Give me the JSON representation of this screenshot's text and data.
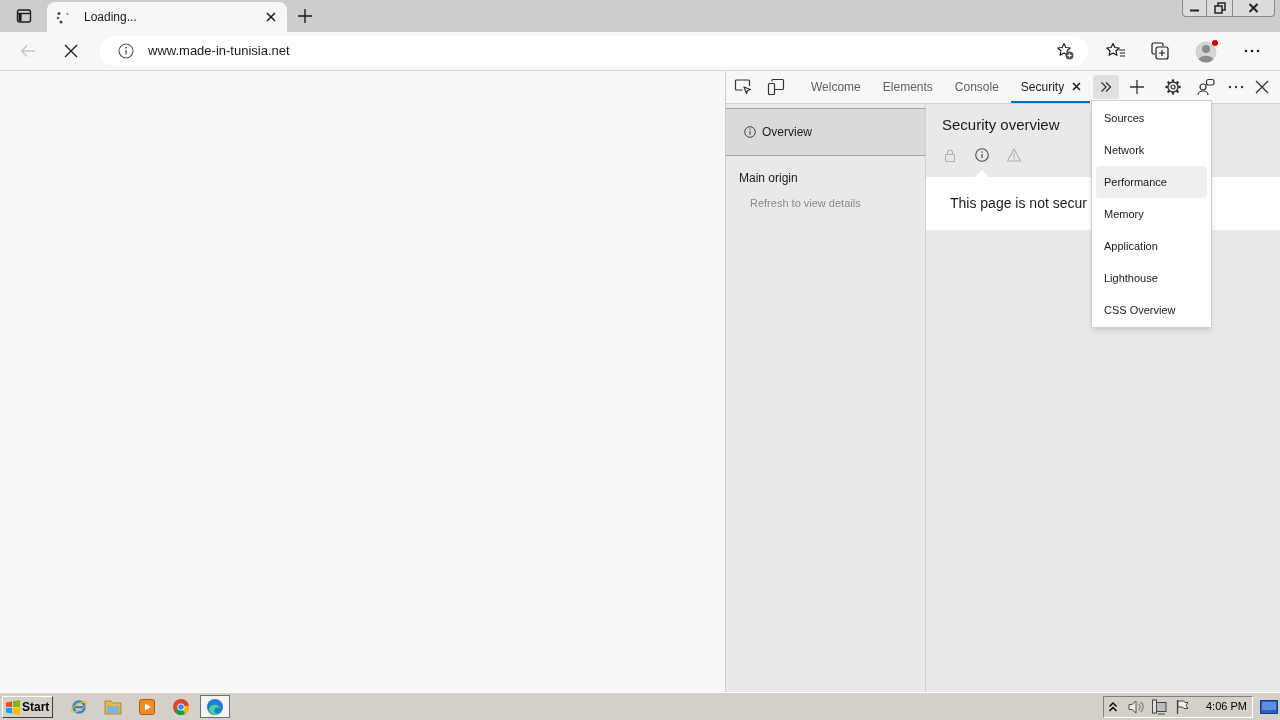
{
  "browser": {
    "tabs": [
      {
        "title": "Loading...",
        "loading": true,
        "selected": true
      }
    ],
    "navigation": {
      "back": {
        "disabled": true
      }
    },
    "address_bar": {
      "url": "www.made-in-tunisia.net"
    }
  },
  "devtools": {
    "tabs": [
      {
        "label": "Welcome",
        "selected": false
      },
      {
        "label": "Elements",
        "selected": false
      },
      {
        "label": "Console",
        "selected": false
      },
      {
        "label": "Security",
        "selected": true
      }
    ],
    "more_tabs_menu": {
      "open": true,
      "items": [
        {
          "label": "Sources",
          "highlighted": false
        },
        {
          "label": "Network",
          "highlighted": false
        },
        {
          "label": "Performance",
          "highlighted": true
        },
        {
          "label": "Memory",
          "highlighted": false
        },
        {
          "label": "Application",
          "highlighted": false
        },
        {
          "label": "Lighthouse",
          "highlighted": false
        },
        {
          "label": "CSS Overview",
          "highlighted": false
        }
      ]
    },
    "sidebar": {
      "items": [
        {
          "label": "Overview",
          "selected": true
        }
      ],
      "sections": [
        {
          "title": "Main origin",
          "hint": "Refresh to view details"
        }
      ]
    },
    "panel": {
      "title": "Security overview",
      "filters": [
        {
          "kind": "lock",
          "selected": false
        },
        {
          "kind": "info",
          "selected": true
        },
        {
          "kind": "warning",
          "selected": false
        }
      ],
      "message": "This page is not secur"
    }
  },
  "taskbar": {
    "start_label": "Start",
    "apps": [
      {
        "kind": "globe",
        "selected": false
      },
      {
        "kind": "folder",
        "selected": false
      },
      {
        "kind": "player",
        "selected": false
      },
      {
        "kind": "ring",
        "selected": false
      },
      {
        "kind": "swirl",
        "selected": true
      }
    ],
    "clock": "4:06 PM"
  }
}
